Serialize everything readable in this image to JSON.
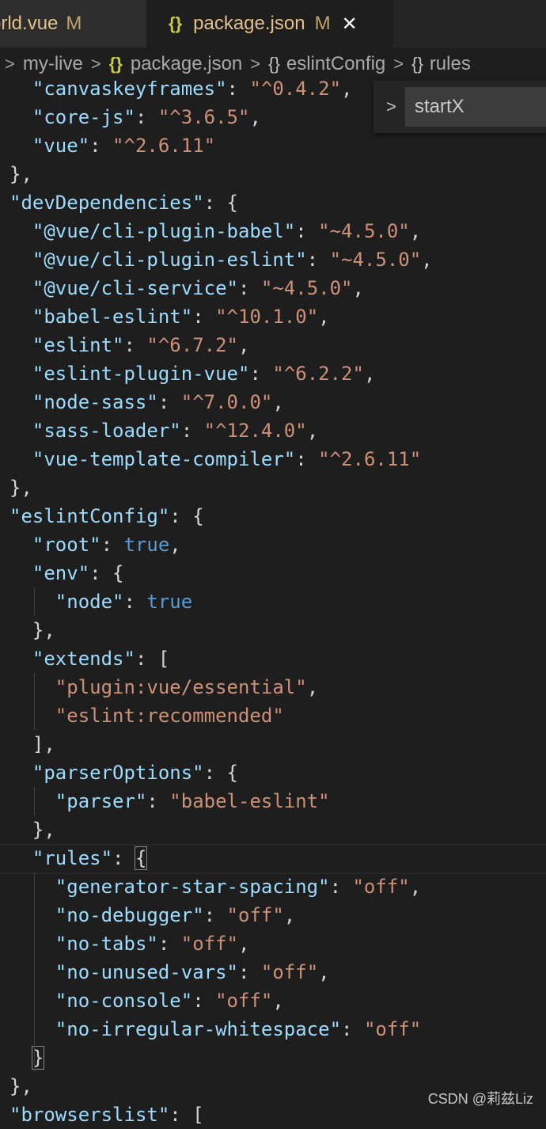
{
  "tabs": [
    {
      "label": "orld.vue",
      "modified": "M"
    },
    {
      "icon": "{}",
      "label": "package.json",
      "modified": "M",
      "close": "✕"
    }
  ],
  "breadcrumb": {
    "chevron": ">",
    "items": [
      {
        "icon": "",
        "label": "my-live"
      },
      {
        "icon": "{}",
        "label": "package.json"
      },
      {
        "icon": "{}",
        "label": "eslintConfig"
      },
      {
        "icon": "{}",
        "label": "rules"
      }
    ]
  },
  "find_widget": {
    "toggle": ">",
    "value": "startX"
  },
  "code_lines": [
    [
      [
        "k",
        "\"canvaskeyframes\""
      ],
      [
        "p",
        ": "
      ],
      [
        "s",
        "\"^0.4.2\""
      ],
      [
        "p",
        ","
      ]
    ],
    [
      [
        "k",
        "\"core-js\""
      ],
      [
        "p",
        ": "
      ],
      [
        "s",
        "\"^3.6.5\""
      ],
      [
        "p",
        ","
      ]
    ],
    [
      [
        "k",
        "\"vue\""
      ],
      [
        "p",
        ": "
      ],
      [
        "s",
        "\"^2.6.11\""
      ]
    ],
    [
      [
        "p",
        "},"
      ]
    ],
    [
      [
        "k",
        "\"devDependencies\""
      ],
      [
        "p",
        ": {"
      ]
    ],
    [
      [
        "k",
        "\"@vue/cli-plugin-babel\""
      ],
      [
        "p",
        ": "
      ],
      [
        "s",
        "\"~4.5.0\""
      ],
      [
        "p",
        ","
      ]
    ],
    [
      [
        "k",
        "\"@vue/cli-plugin-eslint\""
      ],
      [
        "p",
        ": "
      ],
      [
        "s",
        "\"~4.5.0\""
      ],
      [
        "p",
        ","
      ]
    ],
    [
      [
        "k",
        "\"@vue/cli-service\""
      ],
      [
        "p",
        ": "
      ],
      [
        "s",
        "\"~4.5.0\""
      ],
      [
        "p",
        ","
      ]
    ],
    [
      [
        "k",
        "\"babel-eslint\""
      ],
      [
        "p",
        ": "
      ],
      [
        "s",
        "\"^10.1.0\""
      ],
      [
        "p",
        ","
      ]
    ],
    [
      [
        "k",
        "\"eslint\""
      ],
      [
        "p",
        ": "
      ],
      [
        "s",
        "\"^6.7.2\""
      ],
      [
        "p",
        ","
      ]
    ],
    [
      [
        "k",
        "\"eslint-plugin-vue\""
      ],
      [
        "p",
        ": "
      ],
      [
        "s",
        "\"^6.2.2\""
      ],
      [
        "p",
        ","
      ]
    ],
    [
      [
        "k",
        "\"node-sass\""
      ],
      [
        "p",
        ": "
      ],
      [
        "s",
        "\"^7.0.0\""
      ],
      [
        "p",
        ","
      ]
    ],
    [
      [
        "k",
        "\"sass-loader\""
      ],
      [
        "p",
        ": "
      ],
      [
        "s",
        "\"^12.4.0\""
      ],
      [
        "p",
        ","
      ]
    ],
    [
      [
        "k",
        "\"vue-template-compiler\""
      ],
      [
        "p",
        ": "
      ],
      [
        "s",
        "\"^2.6.11\""
      ]
    ],
    [
      [
        "p",
        "},"
      ]
    ],
    [
      [
        "k",
        "\"eslintConfig\""
      ],
      [
        "p",
        ": {"
      ]
    ],
    [
      [
        "k",
        "\"root\""
      ],
      [
        "p",
        ": "
      ],
      [
        "b",
        "true"
      ],
      [
        "p",
        ","
      ]
    ],
    [
      [
        "k",
        "\"env\""
      ],
      [
        "p",
        ": {"
      ]
    ],
    [
      [
        "k",
        "\"node\""
      ],
      [
        "p",
        ": "
      ],
      [
        "b",
        "true"
      ]
    ],
    [
      [
        "p",
        "},"
      ]
    ],
    [
      [
        "k",
        "\"extends\""
      ],
      [
        "p",
        ": ["
      ]
    ],
    [
      [
        "s",
        "\"plugin:vue/essential\""
      ],
      [
        "p",
        ","
      ]
    ],
    [
      [
        "s",
        "\"eslint:recommended\""
      ]
    ],
    [
      [
        "p",
        "],"
      ]
    ],
    [
      [
        "k",
        "\"parserOptions\""
      ],
      [
        "p",
        ": {"
      ]
    ],
    [
      [
        "k",
        "\"parser\""
      ],
      [
        "p",
        ": "
      ],
      [
        "s",
        "\"babel-eslint\""
      ]
    ],
    [
      [
        "p",
        "},"
      ]
    ],
    [
      [
        "k",
        "\"rules\""
      ],
      [
        "p",
        ": "
      ],
      [
        "p",
        "{"
      ]
    ],
    [
      [
        "k",
        "\"generator-star-spacing\""
      ],
      [
        "p",
        ": "
      ],
      [
        "s",
        "\"off\""
      ],
      [
        "p",
        ","
      ]
    ],
    [
      [
        "k",
        "\"no-debugger\""
      ],
      [
        "p",
        ": "
      ],
      [
        "s",
        "\"off\""
      ],
      [
        "p",
        ","
      ]
    ],
    [
      [
        "k",
        "\"no-tabs\""
      ],
      [
        "p",
        ": "
      ],
      [
        "s",
        "\"off\""
      ],
      [
        "p",
        ","
      ]
    ],
    [
      [
        "k",
        "\"no-unused-vars\""
      ],
      [
        "p",
        ": "
      ],
      [
        "s",
        "\"off\""
      ],
      [
        "p",
        ","
      ]
    ],
    [
      [
        "k",
        "\"no-console\""
      ],
      [
        "p",
        ": "
      ],
      [
        "s",
        "\"off\""
      ],
      [
        "p",
        ","
      ]
    ],
    [
      [
        "k",
        "\"no-irregular-whitespace\""
      ],
      [
        "p",
        ": "
      ],
      [
        "s",
        "\"off\""
      ]
    ],
    [
      [
        "p",
        "}"
      ]
    ],
    [
      [
        "p",
        "},"
      ]
    ],
    [
      [
        "k",
        "\"browserslist\""
      ],
      [
        "p",
        ": ["
      ]
    ]
  ],
  "watermark": "CSDN @莉兹Liz"
}
